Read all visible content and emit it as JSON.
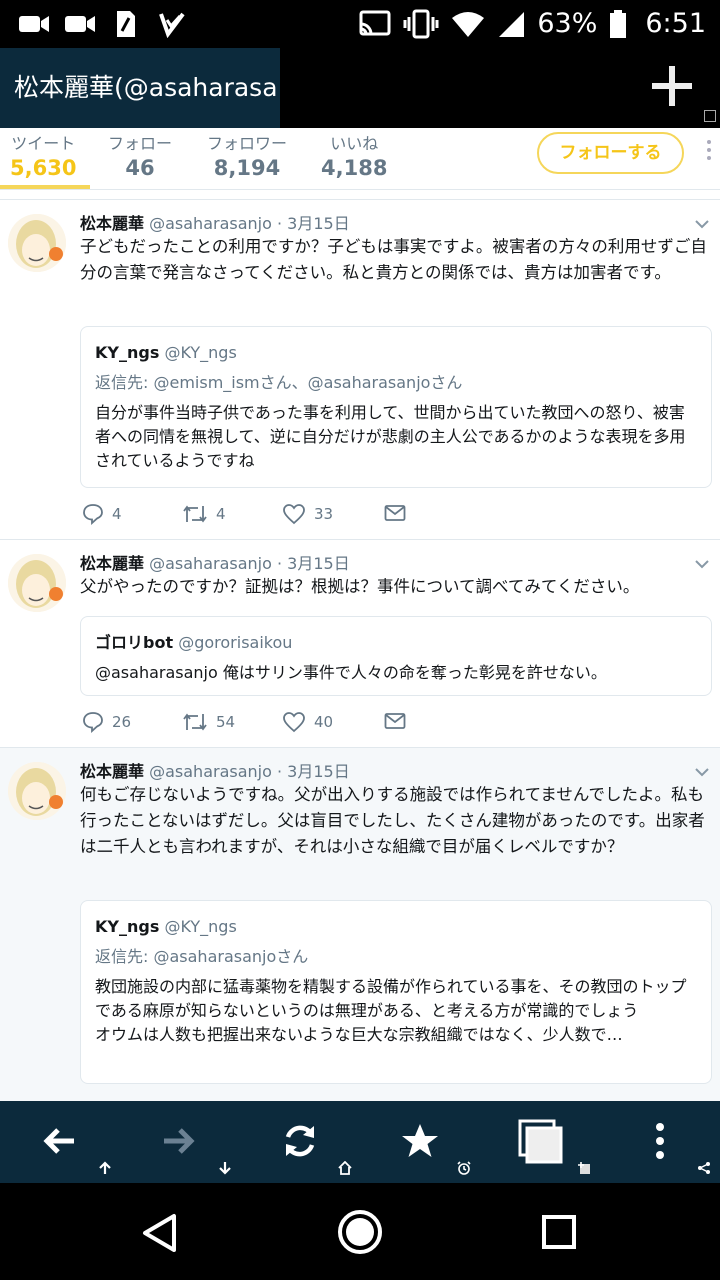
{
  "status_bar": {
    "battery": "63%",
    "time": "6:51",
    "left_icons": [
      "video-camera-icon",
      "video-camera-icon",
      "sim-icon",
      "check-icon"
    ],
    "right_icons": [
      "cast-icon",
      "vibrate-icon",
      "wifi-icon",
      "signal-icon",
      "battery-icon"
    ]
  },
  "title_bar": {
    "title": "松本麗華(@asaharasa…",
    "add_icon": "plus-icon"
  },
  "profile_stats": {
    "tweets": {
      "label": "ツイート",
      "value": "5,630"
    },
    "following": {
      "label": "フォロー",
      "value": "46"
    },
    "followers": {
      "label": "フォロワー",
      "value": "8,194"
    },
    "likes": {
      "label": "いいね",
      "value": "4,188"
    },
    "follow_button": "フォローする",
    "accent_color": "#f5c518"
  },
  "tweets": [
    {
      "name": "松本麗華",
      "handle": "@asaharasanjo · 3月15日",
      "text": "子どもだったことの利用ですか？子どもは事実ですよ。被害者の方々の利用せずご自分の言葉で発言なさってください。私と貴方との関係では、貴方は加害者です。",
      "quote": {
        "name": "KY_ngs",
        "handle": "@KY_ngs",
        "reply_to": "返信先: @emism_ismさん、@asaharasanjoさん",
        "text": "自分が事件当時子供であった事を利用して、世間から出ていた教団への怒り、被害者への同情を無視して、逆に自分だけが悲劇の主人公であるかのような表現を多用されているようですね"
      },
      "replies": "4",
      "retweets": "4",
      "likes": "33"
    },
    {
      "name": "松本麗華",
      "handle": "@asaharasanjo · 3月15日",
      "text": "父がやったのですか？証拠は？根拠は？事件について調べてみてください。",
      "quote": {
        "name": "ゴロリbot",
        "handle": "@gororisaikou",
        "reply_to": "",
        "text": "@asaharasanjo 俺はサリン事件で人々の命を奪った彰晃を許せない。"
      },
      "replies": "26",
      "retweets": "54",
      "likes": "40"
    },
    {
      "name": "松本麗華",
      "handle": "@asaharasanjo · 3月15日",
      "text": "何もご存じないようですね。父が出入りする施設では作られてませんでしたよ。私も行ったことないはずだし。父は盲目でしたし、たくさん建物があったのです。出家者は二千人とも言われますが、それは小さな組織で目が届くレベルですか？",
      "quote": {
        "name": "KY_ngs",
        "handle": "@KY_ngs",
        "reply_to": "返信先: @asaharasanjoさん",
        "text": "教団施設の内部に猛毒薬物を精製する設備が作られている事を、その教団のトップである麻原が知らないというのは無理がある、と考える方が常識的でしょう\nオウムは人数も把握出来ないような巨大な宗教組織ではなく、少人数で…"
      }
    }
  ],
  "toolbar": {
    "icons": [
      "back-arrow-icon",
      "forward-arrow-icon",
      "refresh-icon",
      "star-icon",
      "tabs-icon",
      "more-icon"
    ],
    "sub_icons": [
      "scroll-top-icon",
      "scroll-bottom-icon",
      "home-icon",
      "alarm-icon",
      "new-tab-icon",
      "share-icon"
    ]
  },
  "nav_bar": {
    "icons": [
      "back-triangle-icon",
      "home-circle-icon",
      "recents-square-icon"
    ]
  }
}
